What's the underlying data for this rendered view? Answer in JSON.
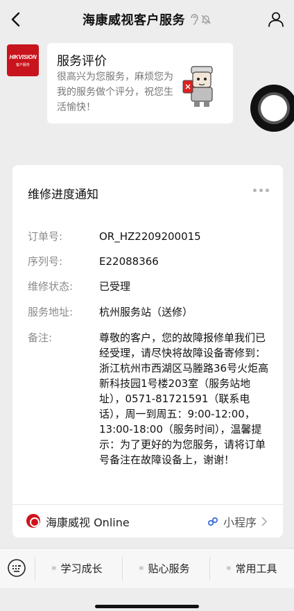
{
  "nav": {
    "title": "海康威视客户服务",
    "back_icon": "back-arrow-icon",
    "ear_icon": "ear-icon",
    "mute_icon": "bell-muted-icon",
    "user_icon": "user-icon"
  },
  "message": {
    "avatar_brand": "HIKVISION",
    "avatar_sub": "客户服务",
    "title": "服务评价",
    "text": "很高兴为您服务，麻烦您为我的服务做个评分，祝您生活愉快！"
  },
  "card": {
    "title": "维修进度通知",
    "fields": [
      {
        "label": "订单号:",
        "value": "OR_HZ2209200015"
      },
      {
        "label": "序列号:",
        "value": "E22088366"
      },
      {
        "label": "维修状态:",
        "value": "已受理"
      },
      {
        "label": "服务地址:",
        "value": "杭州服务站（送修）"
      },
      {
        "label": "备注:",
        "value": "尊敬的客户，您的故障报修单我们已经受理，请尽快将故障设备寄修到：浙江杭州市西湖区马塍路36号火炬高新科技园1号楼203室（服务站地址），0571-81721591（联系电话），周一到周五：9:00-12:00，13:00-18:00（服务时间），温馨提示：为了更好的为您服务，请将订单号备注在故障设备上，谢谢！"
      }
    ],
    "footer_name": "海康威视 Online",
    "footer_link": "小程序"
  },
  "menu": {
    "items": [
      "学习成长",
      "贴心服务",
      "常用工具"
    ]
  },
  "colors": {
    "brand_red": "#c8141c",
    "background": "#ededed",
    "label_gray": "#8a8a8a",
    "link_blue": "#3d6fd6"
  }
}
